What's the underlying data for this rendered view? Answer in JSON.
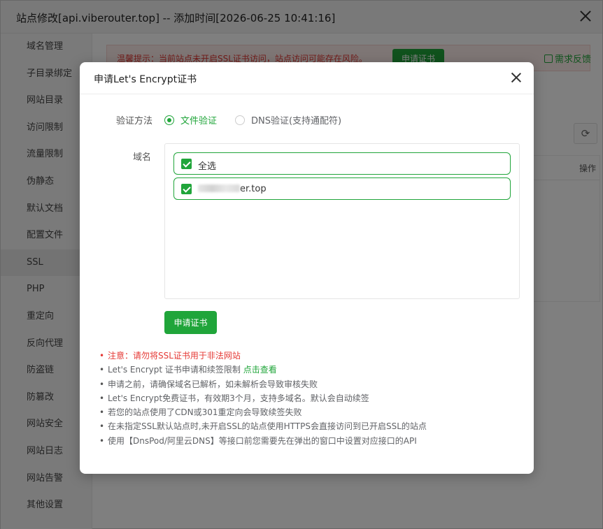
{
  "window": {
    "title": "站点修改[api.viberouter.top] -- 添加时间[2026-06-25 10:41:16]"
  },
  "sidebar": {
    "items": [
      {
        "label": "域名管理"
      },
      {
        "label": "子目录绑定"
      },
      {
        "label": "网站目录"
      },
      {
        "label": "访问限制"
      },
      {
        "label": "流量限制"
      },
      {
        "label": "伪静态"
      },
      {
        "label": "默认文档"
      },
      {
        "label": "配置文件"
      },
      {
        "label": "SSL",
        "active": true
      },
      {
        "label": "PHP"
      },
      {
        "label": "重定向"
      },
      {
        "label": "反向代理"
      },
      {
        "label": "防盗链"
      },
      {
        "label": "防篡改"
      },
      {
        "label": "网站安全"
      },
      {
        "label": "网站日志"
      },
      {
        "label": "网站告警"
      },
      {
        "label": "其他设置"
      }
    ]
  },
  "main": {
    "warning_text": "温馨提示：当前站点未开启SSL证书访问，站点访问可能存在风险。",
    "warning_button": "申请证书",
    "feedback": "需求反馈",
    "table_op_header": "操作",
    "refresh_icon": "⟳"
  },
  "dialog": {
    "title": "申请Let's Encrypt证书",
    "verify_label": "验证方法",
    "verify_options": [
      {
        "label": "文件验证",
        "selected": true
      },
      {
        "label": "DNS验证(支持通配符)",
        "selected": false
      }
    ],
    "domain_label": "域名",
    "select_all": "全选",
    "domain_suffix": "er.top",
    "apply_button": "申请证书",
    "tips": [
      {
        "text": "注意：请勿将SSL证书用于非法网站"
      },
      {
        "text": "Let's Encrypt 证书申请和续签限制 ",
        "link": "点击查看"
      },
      {
        "text": "申请之前，请确保域名已解析，如未解析会导致审核失败"
      },
      {
        "text": "Let's Encrypt免费证书，有效期3个月，支持多域名。默认会自动续签"
      },
      {
        "text": "若您的站点使用了CDN或301重定向会导致续签失败"
      },
      {
        "text": "在未指定SSL默认站点时,未开启SSL的站点使用HTTPS会直接访问到已开启SSL的站点"
      },
      {
        "text": "使用【DnsPod/阿里云DNS】等接口前您需要先在弹出的窗口中设置对应接口的API"
      }
    ]
  },
  "colors": {
    "accent": "#20a53a",
    "warning": "#e53935"
  }
}
